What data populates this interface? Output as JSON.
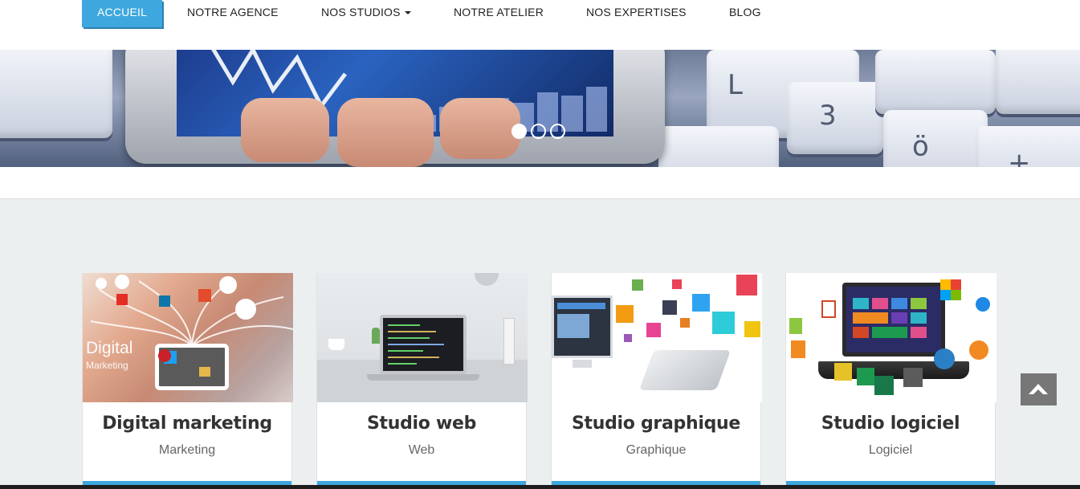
{
  "nav": {
    "items": [
      {
        "label": "ACCUEIL",
        "active": true
      },
      {
        "label": "NOTRE AGENCE",
        "active": false
      },
      {
        "label": "NOS STUDIOS",
        "active": false,
        "dropdown": true
      },
      {
        "label": "NOTRE ATELIER",
        "active": false
      },
      {
        "label": "NOS EXPERTISES",
        "active": false
      },
      {
        "label": "BLOG",
        "active": false
      }
    ]
  },
  "slider": {
    "slide_count": 3,
    "active_index": 0
  },
  "cards": [
    {
      "title": "Digital marketing",
      "subtitle": "Marketing",
      "image_text": "Digital",
      "image_text_2": "Marketing"
    },
    {
      "title": "Studio web",
      "subtitle": "Web"
    },
    {
      "title": "Studio graphique",
      "subtitle": "Graphique"
    },
    {
      "title": "Studio logiciel",
      "subtitle": "Logiciel"
    }
  ],
  "colors": {
    "accent": "#3ea8de",
    "section_bg": "#ecefef",
    "back_to_top_bg": "#777777"
  },
  "icons": {
    "back_to_top": "chevron-up-icon",
    "dropdown": "caret-down-icon"
  }
}
